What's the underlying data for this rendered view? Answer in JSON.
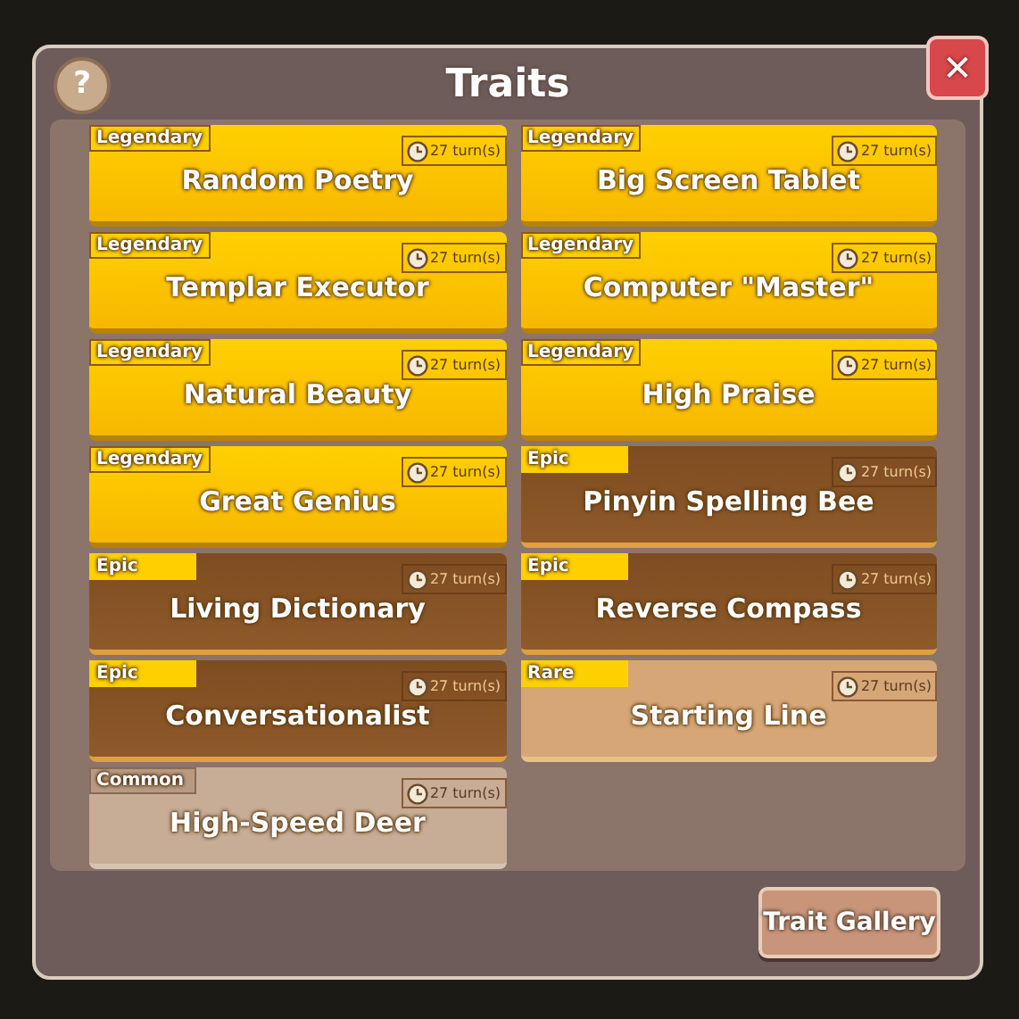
{
  "dialog": {
    "title": "Traits",
    "help_label": "?",
    "close_label": "✕"
  },
  "traits": [
    {
      "rarity": "Legendary",
      "kind": "legendary",
      "name": "Random Poetry",
      "duration": "27 turn(s)"
    },
    {
      "rarity": "Legendary",
      "kind": "legendary",
      "name": "Big Screen Tablet",
      "duration": "27 turn(s)"
    },
    {
      "rarity": "Legendary",
      "kind": "legendary",
      "name": "Templar Executor",
      "duration": "27 turn(s)"
    },
    {
      "rarity": "Legendary",
      "kind": "legendary",
      "name": "Computer \"Master\"",
      "duration": "27 turn(s)"
    },
    {
      "rarity": "Legendary",
      "kind": "legendary",
      "name": "Natural Beauty",
      "duration": "27 turn(s)"
    },
    {
      "rarity": "Legendary",
      "kind": "legendary",
      "name": "High Praise",
      "duration": "27 turn(s)"
    },
    {
      "rarity": "Legendary",
      "kind": "legendary",
      "name": "Great Genius",
      "duration": "27 turn(s)"
    },
    {
      "rarity": "Epic",
      "kind": "epic",
      "name": "Pinyin Spelling Bee",
      "duration": "27 turn(s)"
    },
    {
      "rarity": "Epic",
      "kind": "epic",
      "name": "Living Dictionary",
      "duration": "27 turn(s)"
    },
    {
      "rarity": "Epic",
      "kind": "epic",
      "name": "Reverse Compass",
      "duration": "27 turn(s)"
    },
    {
      "rarity": "Epic",
      "kind": "epic",
      "name": "Conversationalist",
      "duration": "27 turn(s)"
    },
    {
      "rarity": "Rare",
      "kind": "rare",
      "name": "Starting Line",
      "duration": "27 turn(s)"
    },
    {
      "rarity": "Common",
      "kind": "common",
      "name": "High-Speed Deer",
      "duration": "27 turn(s)"
    }
  ],
  "gallery_button": "Trait Gallery"
}
